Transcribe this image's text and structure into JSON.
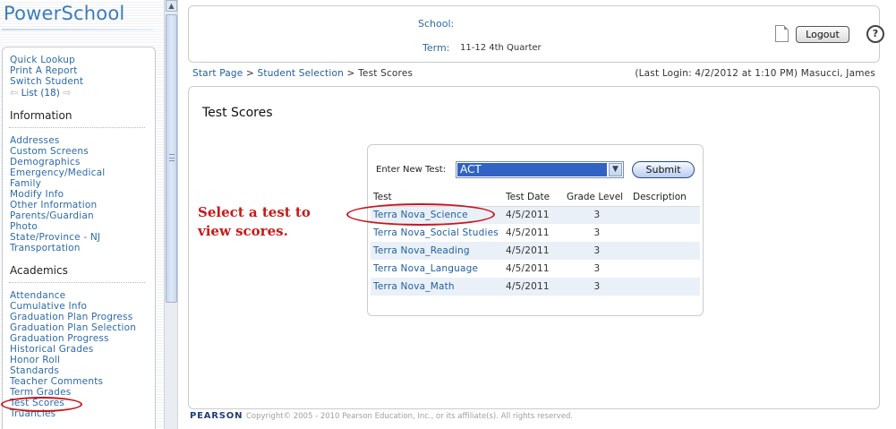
{
  "app": {
    "logo": "PowerSchool"
  },
  "nav": {
    "quick_links": [
      "Quick Lookup",
      "Print A Report",
      "Switch Student"
    ],
    "list_label": "List (18)",
    "sections": [
      {
        "title": "Information",
        "items": [
          "Addresses",
          "Custom Screens",
          "Demographics",
          "Emergency/Medical",
          "Family",
          "Modify Info",
          "Other Information",
          "Parents/Guardian",
          "Photo",
          "State/Province - NJ",
          "Transportation"
        ]
      },
      {
        "title": "Academics",
        "items": [
          "Attendance",
          "Cumulative Info",
          "Graduation Plan Progress",
          "Graduation Plan Selection",
          "Graduation Progress",
          "Historical Grades",
          "Honor Roll",
          "Standards",
          "Teacher Comments",
          "Term Grades",
          "Test Scores",
          "Truancies"
        ]
      }
    ]
  },
  "header": {
    "school_label": "School:",
    "term_label": "Term:",
    "term_value": "11-12 4th Quarter",
    "logout_label": "Logout",
    "help_label": "?"
  },
  "breadcrumb": {
    "items": [
      "Start Page",
      "Student Selection"
    ],
    "separator": ">",
    "current": "Test Scores"
  },
  "last_login": "(Last Login: 4/2/2012 at 1:10 PM) Masucci, James",
  "page": {
    "title": "Test Scores",
    "annotation": "Select a test to view scores.",
    "new_test_label": "Enter New Test:",
    "selected_test": "ACT",
    "submit_label": "Submit",
    "columns": [
      "Test",
      "Test Date",
      "Grade Level",
      "Description"
    ],
    "rows": [
      {
        "test": "Terra Nova_Science",
        "date": "4/5/2011",
        "grade": "3",
        "description": ""
      },
      {
        "test": "Terra Nova_Social Studies",
        "date": "4/5/2011",
        "grade": "3",
        "description": ""
      },
      {
        "test": "Terra Nova_Reading",
        "date": "4/5/2011",
        "grade": "3",
        "description": ""
      },
      {
        "test": "Terra Nova_Language",
        "date": "4/5/2011",
        "grade": "3",
        "description": ""
      },
      {
        "test": "Terra Nova_Math",
        "date": "4/5/2011",
        "grade": "3",
        "description": ""
      }
    ]
  },
  "footer": {
    "logo": "PEARSON",
    "copyright": "Copyright© 2005 - 2010 Pearson Education, Inc., or its affiliate(s). All rights reserved."
  },
  "colors": {
    "link": "#1f5fa0",
    "annotation": "#c61a1a",
    "selection": "#3163c5"
  }
}
